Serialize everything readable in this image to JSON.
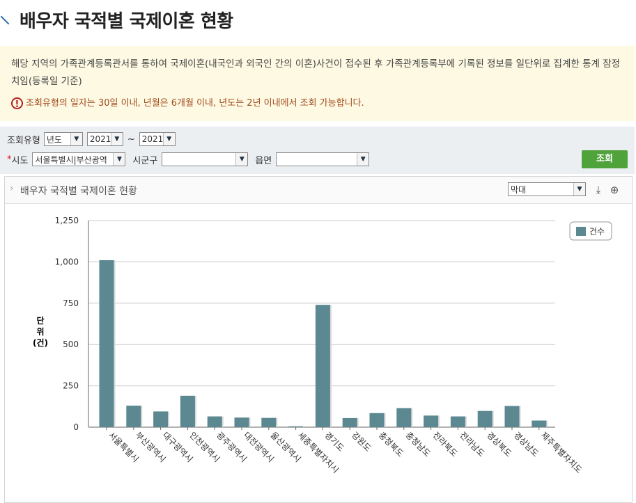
{
  "page": {
    "title": "배우자 국적별 국제이혼 현황"
  },
  "notice": {
    "text": "해당 지역의 가족관계등록관서를 통하여 국제이혼(내국인과 외국인 간의 이혼)사건이 접수된 후 가족관계등록부에 기록된 정보를 일단위로 집계한 통계 잠정치임(등록일 기준)",
    "warning_icon": "!",
    "warning": "조회유형의 일자는 30일 이내, 년월은 6개월 이내, 년도는 2년 이내에서 조회 가능합니다."
  },
  "filters": {
    "type_label": "조회유형",
    "type_value": "년도",
    "year_from": "2021",
    "tilde": "~",
    "year_to": "2021",
    "required_mark": "*",
    "sido_label": "시도",
    "sido_value": "서울특별시|부산광역",
    "sigungu_label": "시군구",
    "sigungu_value": "",
    "eupmyeon_label": "읍면",
    "eupmyeon_value": "",
    "search_button": "조회",
    "dropdown_arrow": "▼"
  },
  "panel": {
    "title": "배우자 국적별 국제이혼 현황",
    "chevron": "›",
    "chart_type_value": "막대",
    "download_icon": "⤓",
    "zoom_icon": "⊕"
  },
  "chart_data": {
    "type": "bar",
    "ylabel": "단\n위\n(건)",
    "ylim": [
      0,
      1250
    ],
    "yticks": [
      0,
      250,
      500,
      750,
      1000,
      1250
    ],
    "ytick_labels": [
      "0",
      "250",
      "500",
      "750",
      "1,000",
      "1,250"
    ],
    "grid": true,
    "legend": "top-right",
    "color": "#5b8891",
    "categories": [
      "서울특별시",
      "부산광역시",
      "대구광역시",
      "인천광역시",
      "광주광역시",
      "대전광역시",
      "울산광역시",
      "세종특별자치시",
      "경기도",
      "강원도",
      "충청북도",
      "충청남도",
      "전라북도",
      "전라남도",
      "경상북도",
      "경상남도",
      "제주특별자치도"
    ],
    "series": [
      {
        "name": "건수",
        "values": [
          1010,
          130,
          95,
          190,
          65,
          58,
          56,
          5,
          740,
          55,
          85,
          115,
          70,
          65,
          98,
          128,
          40
        ]
      }
    ]
  }
}
